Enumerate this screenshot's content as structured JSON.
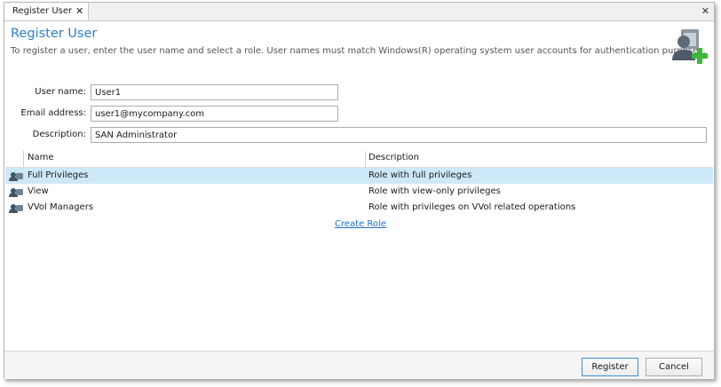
{
  "tab": {
    "label": "Register User",
    "close": "✕"
  },
  "window": {
    "close": "✕"
  },
  "header": {
    "title": "Register User",
    "description": "To register a user, enter the user name and select a role. User names must match Windows(R) operating system user accounts for authentication purposes."
  },
  "form": {
    "username_label": "User name:",
    "username_value": "User1",
    "email_label": "Email address:",
    "email_value": "user1@mycompany.com",
    "description_label": "Description:",
    "description_value": "SAN Administrator"
  },
  "roles": {
    "columns": [
      "Name",
      "Description"
    ],
    "rows": [
      {
        "name": "Full Privileges",
        "description": "Role with full privileges",
        "selected": true
      },
      {
        "name": "View",
        "description": "Role with view-only privileges",
        "selected": false
      },
      {
        "name": "VVol Managers",
        "description": "Role with privileges on VVol related operations",
        "selected": false
      }
    ],
    "create_link": "Create Role",
    "row_icon": "role-icon"
  },
  "footer": {
    "register_label": "Register",
    "cancel_label": "Cancel"
  },
  "colors": {
    "accent": "#2f7fc4",
    "selected_row": "#cde8f8",
    "link": "#1e6fc1",
    "icon_green": "#3cb83c"
  },
  "icons": {
    "header": "user-add-icon",
    "close": "close-icon"
  }
}
